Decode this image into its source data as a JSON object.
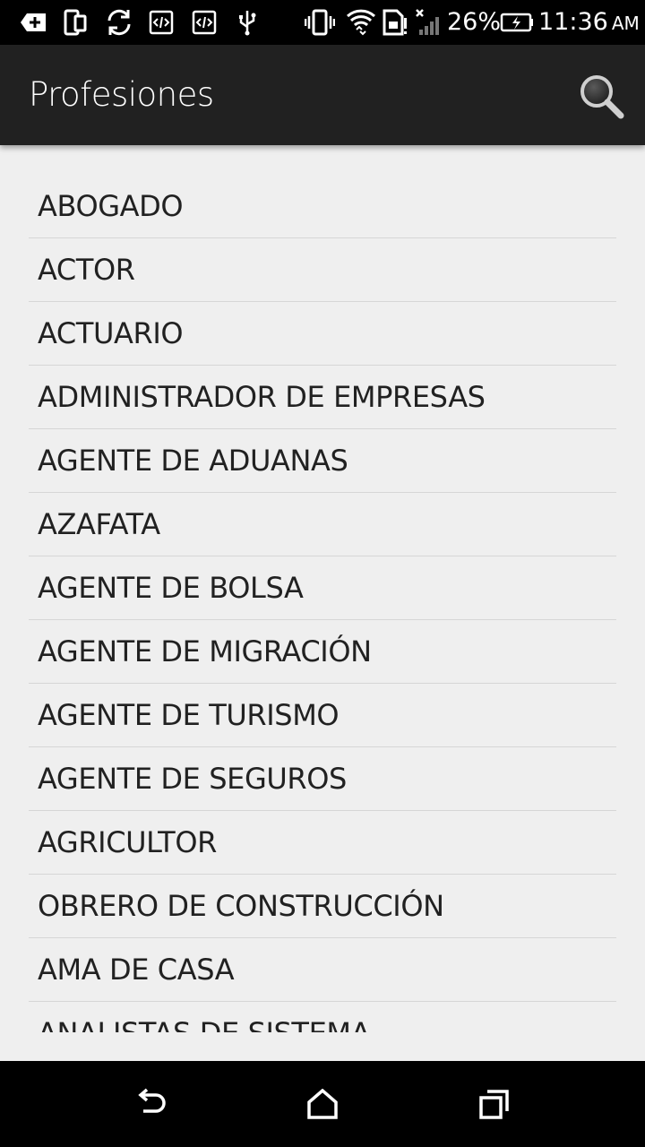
{
  "status_bar": {
    "battery_percent": "26%",
    "time": "11:36",
    "ampm": "AM",
    "icons": [
      "add-notification-icon",
      "device-icon",
      "sync-icon",
      "code-icon",
      "code-icon",
      "usb-icon",
      "vibrate-icon",
      "wifi-icon",
      "sim-icon",
      "signal-icon",
      "battery-charging-icon"
    ]
  },
  "app_bar": {
    "title": "Profesiones",
    "search_icon": "search-icon"
  },
  "list": {
    "items": [
      "ABOGADO",
      "ACTOR",
      "ACTUARIO",
      "ADMINISTRADOR DE EMPRESAS",
      "AGENTE DE ADUANAS",
      "AZAFATA",
      "AGENTE DE BOLSA",
      "AGENTE DE MIGRACIÓN",
      "AGENTE DE TURISMO",
      "AGENTE DE SEGUROS",
      "AGRICULTOR",
      "OBRERO DE CONSTRUCCIÓN",
      "AMA DE CASA",
      "ANALISTAS DE SISTEMA"
    ]
  },
  "nav_bar": {
    "icons": [
      "back-icon",
      "home-icon",
      "recents-icon"
    ]
  },
  "colors": {
    "status_bar": "#000000",
    "app_bar": "#212121",
    "list_background": "#efefef",
    "divider": "#d6d6d6",
    "text": "#212121"
  }
}
